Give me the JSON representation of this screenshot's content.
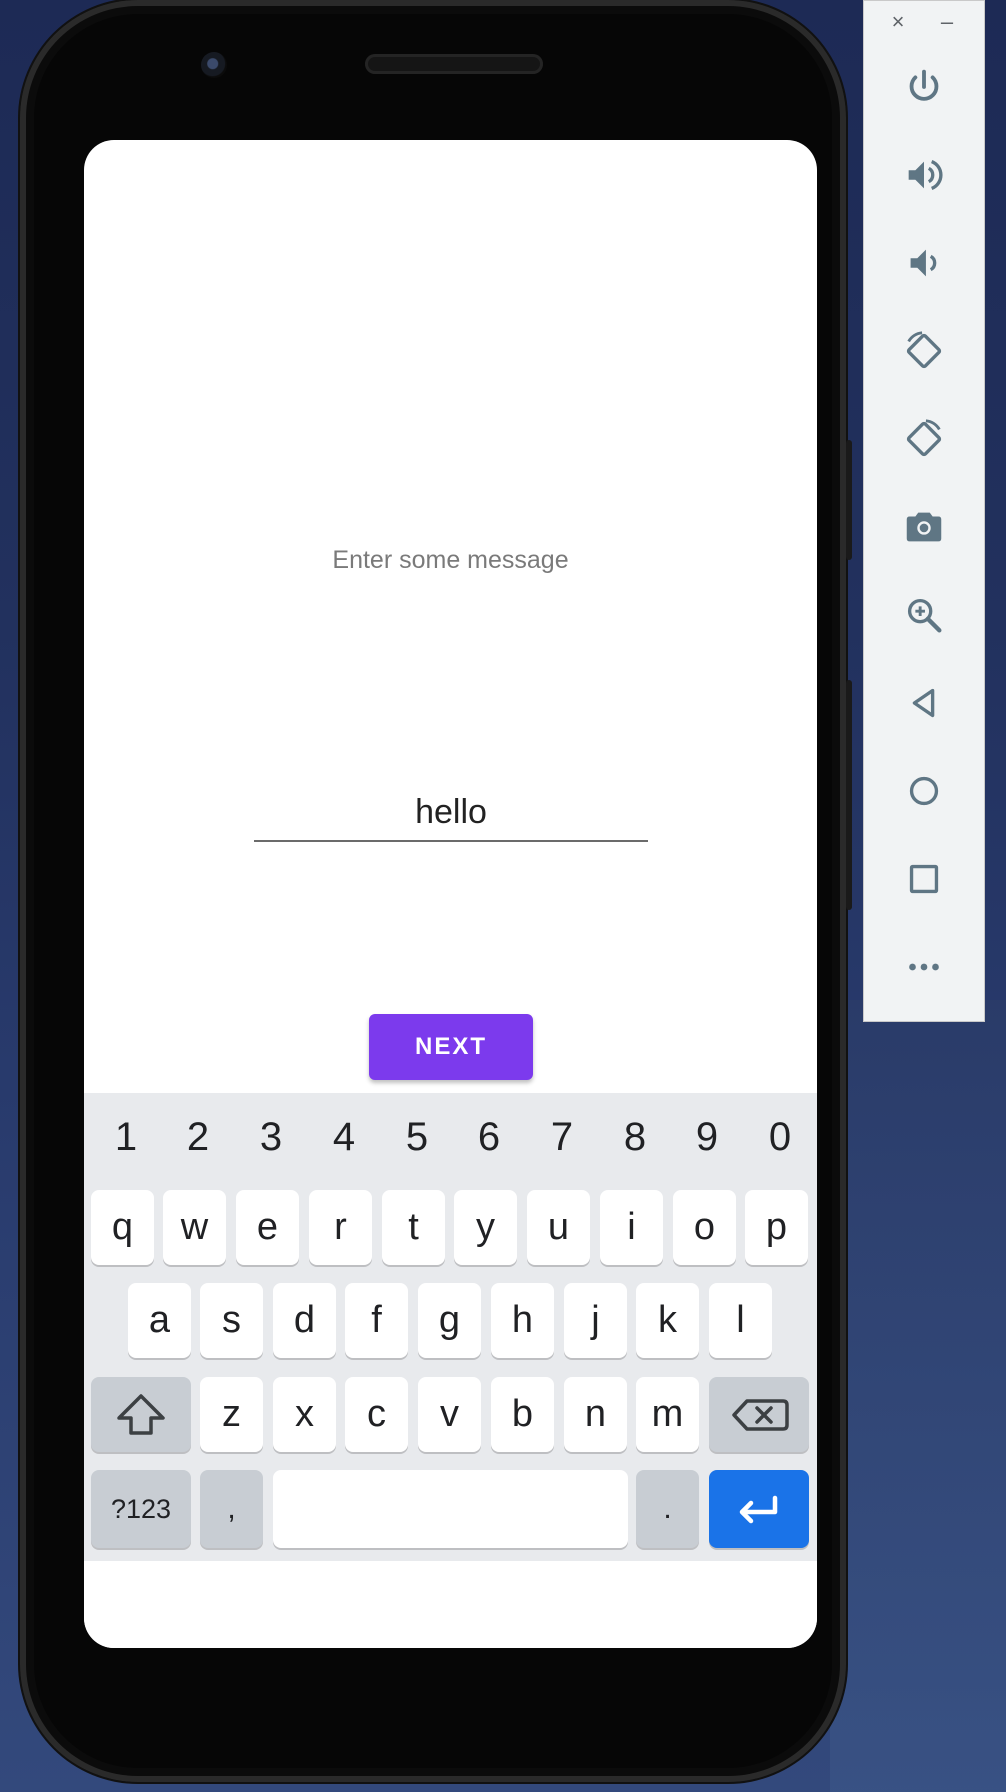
{
  "app": {
    "prompt_text": "Enter some message",
    "input_value": "hello",
    "next_button_label": "NEXT"
  },
  "keyboard": {
    "number_row": [
      "1",
      "2",
      "3",
      "4",
      "5",
      "6",
      "7",
      "8",
      "9",
      "0"
    ],
    "row1": [
      "q",
      "w",
      "e",
      "r",
      "t",
      "y",
      "u",
      "i",
      "o",
      "p"
    ],
    "row2": [
      "a",
      "s",
      "d",
      "f",
      "g",
      "h",
      "j",
      "k",
      "l"
    ],
    "row3": [
      "z",
      "x",
      "c",
      "v",
      "b",
      "n",
      "m"
    ],
    "symbols_label": "?123",
    "comma_label": ",",
    "period_label": ".",
    "icons": {
      "shift": "shift-icon",
      "backspace": "backspace-icon",
      "enter": "enter-icon"
    }
  },
  "emulator_panel": {
    "close_glyph": "×",
    "minimize_glyph": "–",
    "buttons": [
      "power-icon",
      "volume-up-icon",
      "volume-down-icon",
      "rotate-left-icon",
      "rotate-right-icon",
      "camera-icon",
      "zoom-icon",
      "back-icon",
      "home-icon",
      "overview-icon",
      "more-icon"
    ]
  },
  "colors": {
    "accent": "#7c3aed",
    "keyboard_bg": "#e8eaed",
    "enter_key": "#1a73e8",
    "panel_icon": "#5f7684"
  }
}
